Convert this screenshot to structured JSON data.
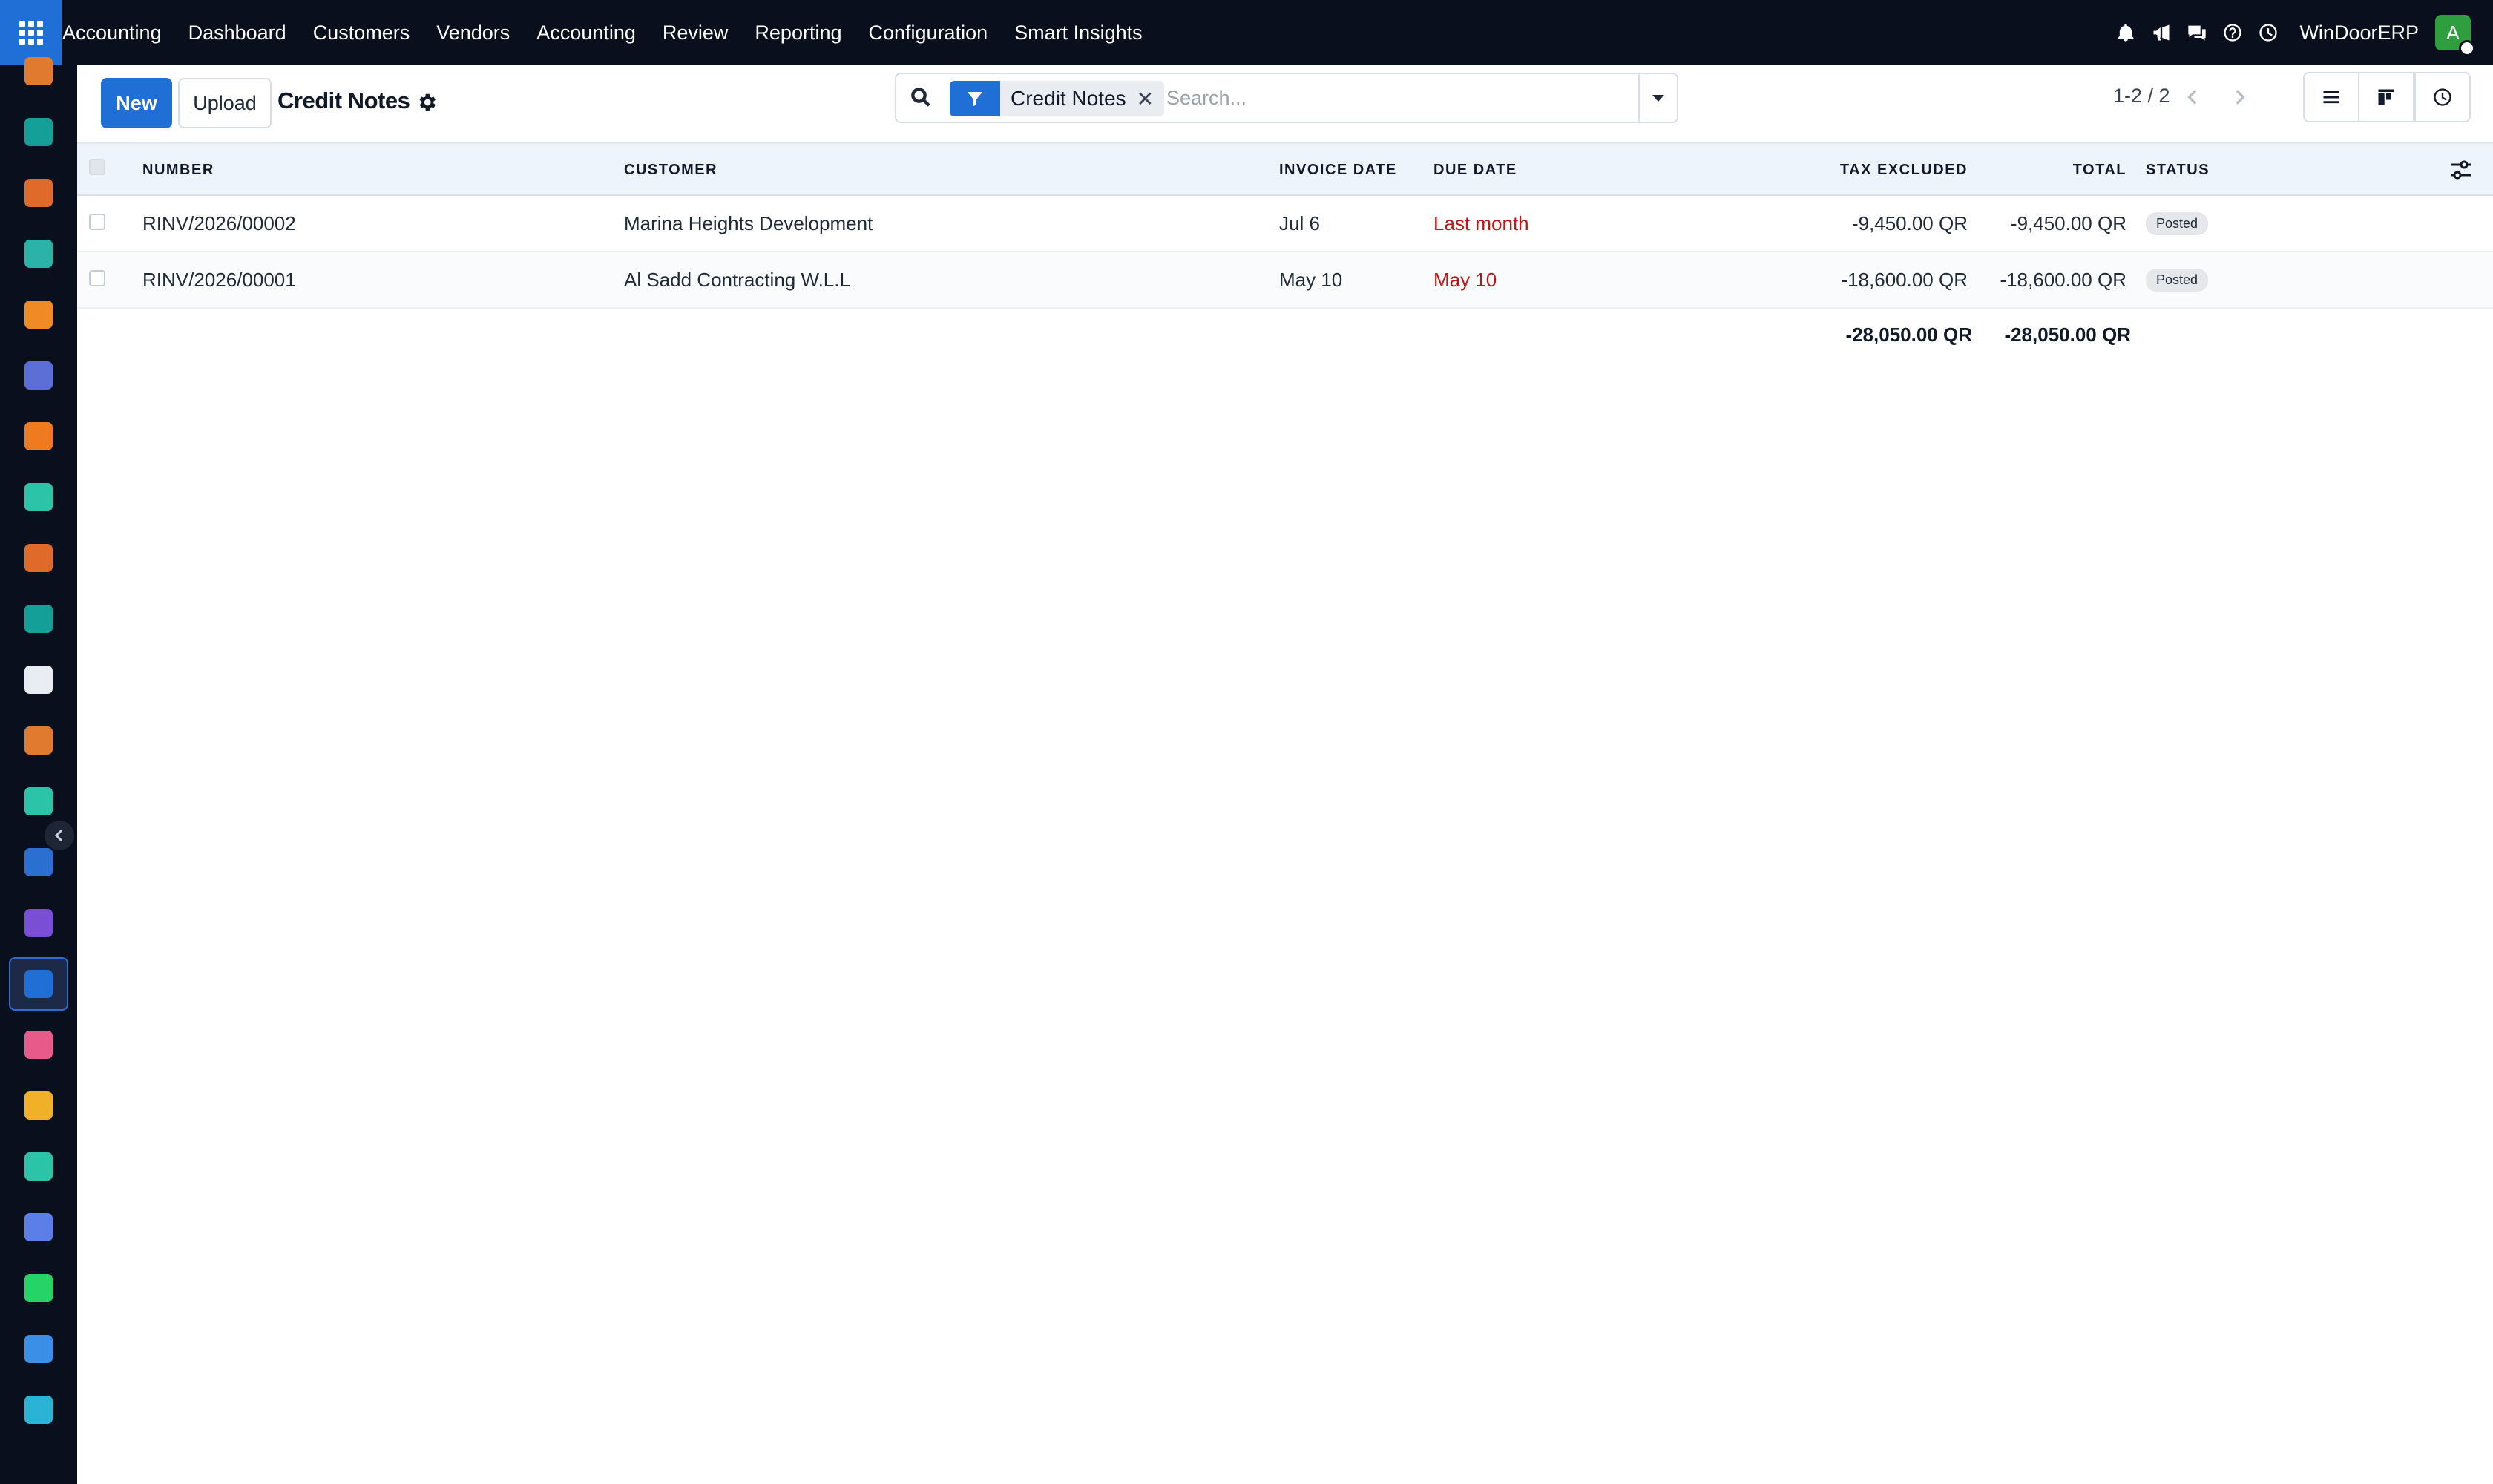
{
  "topbar": {
    "brand": "Accounting",
    "menu": [
      "Dashboard",
      "Customers",
      "Vendors",
      "Accounting",
      "Review",
      "Reporting",
      "Configuration",
      "Smart Insights"
    ],
    "icons": [
      "bell-icon",
      "megaphone-icon",
      "chat-icon",
      "help-icon",
      "clock-icon"
    ],
    "company": "WinDoorERP",
    "avatar_letter": "A"
  },
  "sidebar": {
    "apps": [
      {
        "name": "app-1",
        "color": "#e07a2e"
      },
      {
        "name": "app-contacts",
        "color": "#14a098"
      },
      {
        "name": "app-reports",
        "color": "#e06a2a"
      },
      {
        "name": "app-pie",
        "color": "#2bb3a8"
      },
      {
        "name": "app-chat",
        "color": "#f08a24"
      },
      {
        "name": "app-mail",
        "color": "#5b6fd6"
      },
      {
        "name": "app-discuss",
        "color": "#f07a20"
      },
      {
        "name": "app-check",
        "color": "#2bc4a8"
      },
      {
        "name": "app-stats",
        "color": "#e06a2a"
      },
      {
        "name": "app-employees",
        "color": "#14a098"
      },
      {
        "name": "app-inventory",
        "color": "#e9edf3"
      },
      {
        "name": "app-pos",
        "color": "#e07a2e"
      },
      {
        "name": "app-tasks",
        "color": "#2bc4a8"
      },
      {
        "name": "app-knowledge",
        "color": "#2b6fd0"
      },
      {
        "name": "app-box",
        "color": "#7a4fd6"
      },
      {
        "name": "app-invoicing",
        "color": "#1f6fd6"
      },
      {
        "name": "app-team",
        "color": "#e85a8a"
      },
      {
        "name": "app-calendar",
        "color": "#f0b028"
      },
      {
        "name": "app-sign",
        "color": "#2bc4a8"
      },
      {
        "name": "app-dashboard",
        "color": "#5b7fe6"
      },
      {
        "name": "app-whatsapp",
        "color": "#25d366"
      },
      {
        "name": "app-timer",
        "color": "#3b8fe6"
      },
      {
        "name": "app-odoo",
        "color": "#2bb3d6"
      }
    ],
    "active_index": 15
  },
  "control": {
    "new_label": "New",
    "upload_label": "Upload",
    "title": "Credit Notes",
    "search": {
      "facet": "Credit Notes",
      "placeholder": "Search..."
    },
    "pager": "1-2 / 2"
  },
  "table": {
    "headers": {
      "number": "NUMBER",
      "customer": "CUSTOMER",
      "invoice_date": "INVOICE DATE",
      "due_date": "DUE DATE",
      "tax_excluded": "TAX EXCLUDED",
      "total": "TOTAL",
      "status": "STATUS"
    },
    "rows": [
      {
        "number": "RINV/2026/00002",
        "customer": "Marina Heights Development",
        "invoice_date": "Jul 6",
        "due_date": "Last month",
        "tax_excluded": "-9,450.00 QR",
        "total": "-9,450.00 QR",
        "status": "Posted"
      },
      {
        "number": "RINV/2026/00001",
        "customer": "Al Sadd Contracting W.L.L",
        "invoice_date": "May 10",
        "due_date": "May 10",
        "tax_excluded": "-18,600.00 QR",
        "total": "-18,600.00 QR",
        "status": "Posted"
      }
    ],
    "totals": {
      "tax_excluded": "-28,050.00 QR",
      "total": "-28,050.00 QR"
    }
  },
  "colors": {
    "topbar_bg": "#0a0f1e",
    "primary": "#1f6fd6",
    "overdue": "#c01515",
    "header_bg": "#eef4fc"
  }
}
